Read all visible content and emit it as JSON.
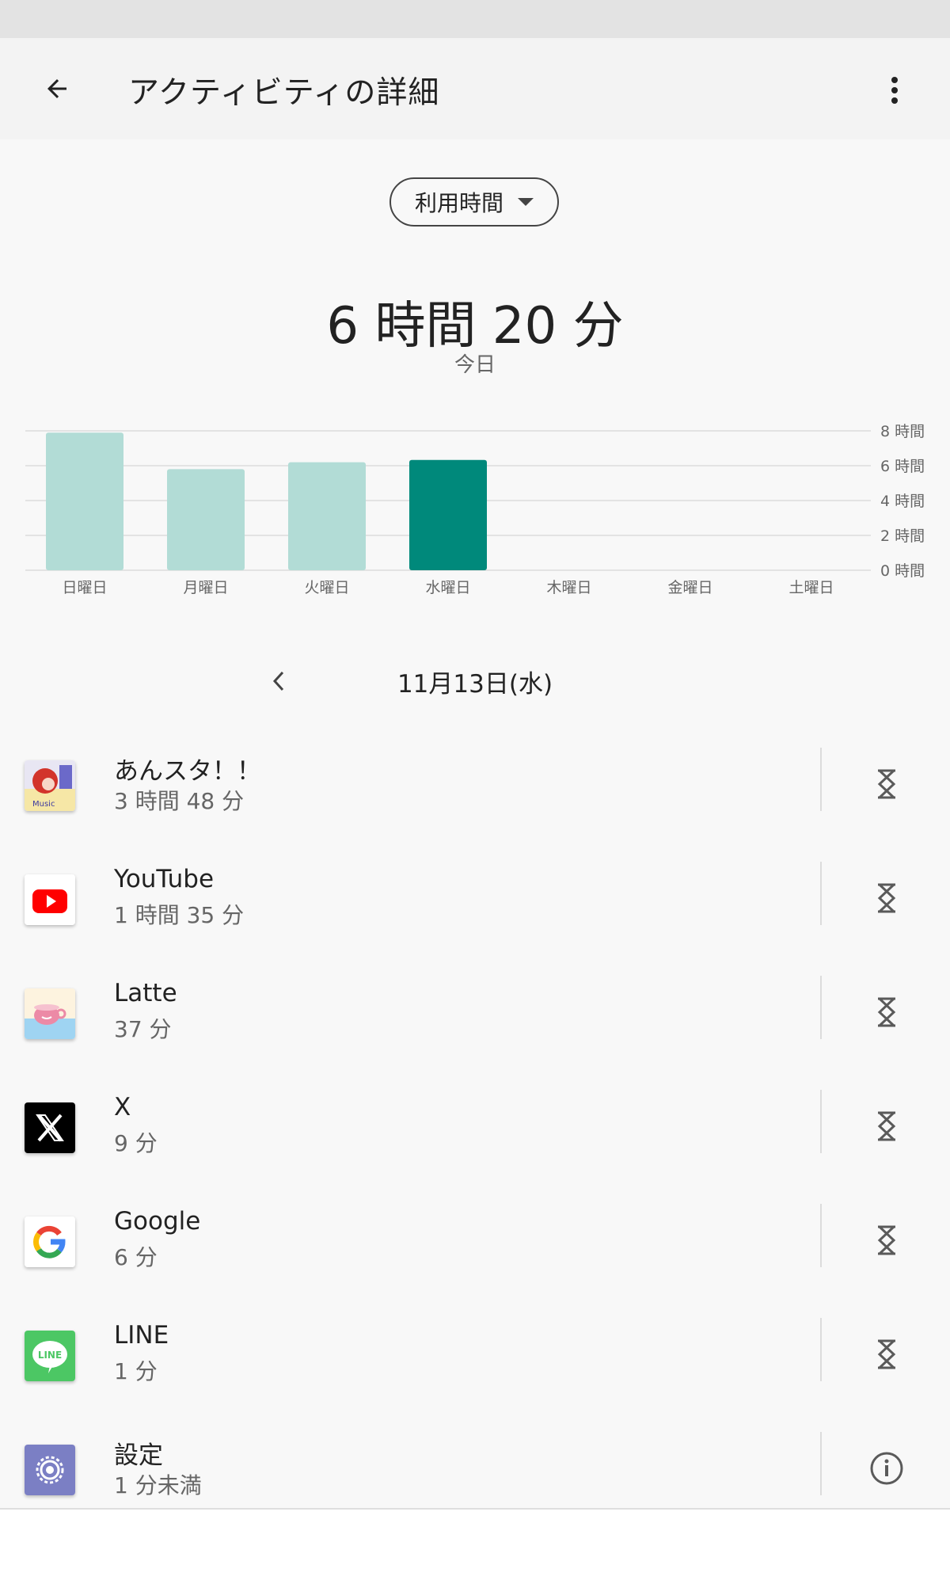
{
  "header": {
    "title": "アクティビティの詳細",
    "back_icon": "arrow-back-icon",
    "menu_icon": "more-vert-icon"
  },
  "filter": {
    "selected": "利用時間"
  },
  "summary": {
    "total": "6 時間 20 分",
    "period": "今日"
  },
  "chart_data": {
    "type": "bar",
    "categories": [
      "日曜日",
      "月曜日",
      "火曜日",
      "水曜日",
      "木曜日",
      "金曜日",
      "土曜日"
    ],
    "values": [
      7.9,
      5.8,
      6.2,
      6.33,
      0,
      0,
      0
    ],
    "highlight_index": 3,
    "ylim": [
      0,
      8
    ],
    "yticks": [
      "8 時間",
      "6 時間",
      "4 時間",
      "2 時間",
      "0 時間"
    ],
    "colors": {
      "bar": "#b2dcd6",
      "highlight": "#00897b",
      "grid": "#e3e3e3"
    },
    "grid": true
  },
  "date_nav": {
    "date": "11月13日(水)",
    "prev_icon": "chevron-left-icon"
  },
  "apps": [
    {
      "name": "あんスタ！！",
      "usage": "3 時間 48 分",
      "icon": "ensemble-stars-app-icon",
      "action": "hourglass-icon"
    },
    {
      "name": "YouTube",
      "usage": "1 時間 35 分",
      "icon": "youtube-app-icon",
      "action": "hourglass-icon"
    },
    {
      "name": "Latte",
      "usage": "37 分",
      "icon": "latte-app-icon",
      "action": "hourglass-icon"
    },
    {
      "name": "X",
      "usage": "9 分",
      "icon": "x-app-icon",
      "action": "hourglass-icon"
    },
    {
      "name": "Google",
      "usage": "6 分",
      "icon": "google-app-icon",
      "action": "hourglass-icon"
    },
    {
      "name": "LINE",
      "usage": "1 分",
      "icon": "line-app-icon",
      "action": "hourglass-icon"
    },
    {
      "name": "設定",
      "usage": "1 分未満",
      "icon": "settings-app-icon",
      "action": "info-icon"
    }
  ]
}
